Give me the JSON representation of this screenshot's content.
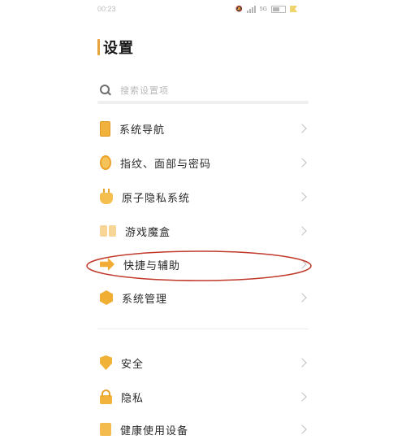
{
  "status_bar": {
    "time": "00:23",
    "network": "5G"
  },
  "page": {
    "title": "设置"
  },
  "search": {
    "placeholder": "搜索设置项"
  },
  "menu_group_1": [
    {
      "label": "系统导航",
      "icon": "phone-icon"
    },
    {
      "label": "指纹、面部与密码",
      "icon": "fingerprint-icon"
    },
    {
      "label": "原子隐私系统",
      "icon": "atom-privacy-icon"
    },
    {
      "label": "游戏魔盒",
      "icon": "game-box-icon"
    },
    {
      "label": "快捷与辅助",
      "icon": "shortcut-arrow-icon"
    },
    {
      "label": "系统管理",
      "icon": "system-hexagon-icon"
    }
  ],
  "menu_group_2": [
    {
      "label": "安全",
      "icon": "shield-icon"
    },
    {
      "label": "隐私",
      "icon": "lock-icon"
    },
    {
      "label": "健康使用设备",
      "icon": "health-icon"
    }
  ],
  "colors": {
    "accent": "#e8a23a",
    "annotation": "#c0392b"
  }
}
